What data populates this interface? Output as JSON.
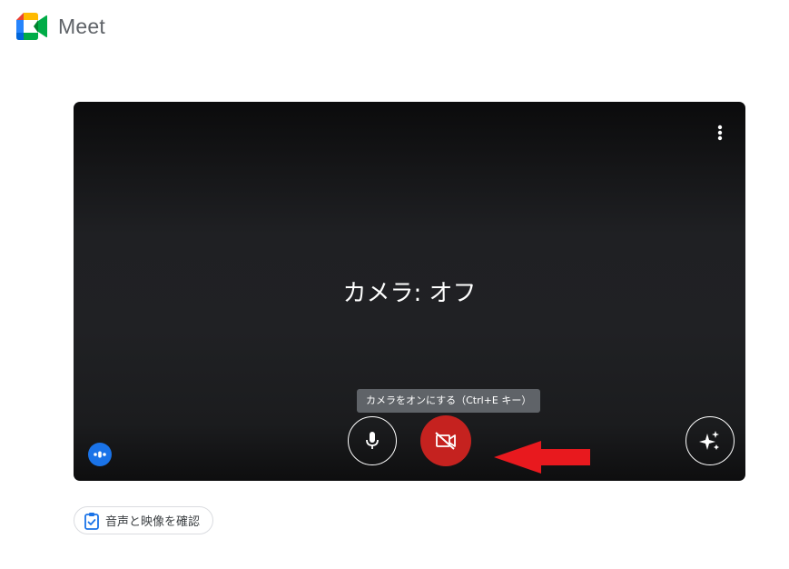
{
  "app": {
    "name": "Meet",
    "logo_icon": "google-meet-logo-icon",
    "colors": {
      "green": "#00AC47",
      "blue": "#2684FC",
      "yellow": "#FFBA00",
      "red": "#EA4335",
      "dark_green": "#00832D"
    }
  },
  "preview": {
    "camera_status": "カメラ: オフ",
    "more_options_icon": "more-vert-icon",
    "tooltip": "カメラをオンにする（Ctrl+E キー）",
    "controls": {
      "mic_icon": "microphone-icon",
      "camera_icon": "videocam-off-icon",
      "camera_button_color": "#c5221f",
      "effects_icon": "sparkle-effects-icon"
    },
    "audio_indicator_icon": "audio-level-icon",
    "audio_indicator_color": "#1a73e8"
  },
  "annotation": {
    "arrow_color": "#e8191e"
  },
  "check_button": {
    "icon": "clipboard-check-icon",
    "label": "音声と映像を確認"
  }
}
